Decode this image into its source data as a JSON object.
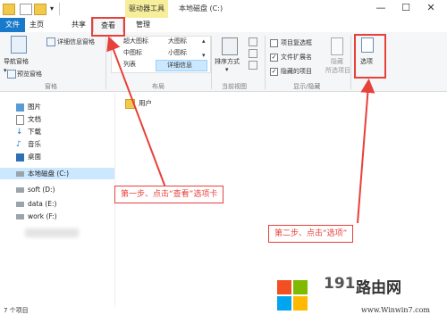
{
  "titlebar": {
    "context_tab": "驱动器工具",
    "title": "本地磁盘 (C:)",
    "minimize": "—",
    "maximize": "☐",
    "close": "✕"
  },
  "tabs": {
    "file": "文件",
    "home": "主页",
    "share": "共享",
    "view": "查看",
    "manage": "管理"
  },
  "ribbon": {
    "panes": {
      "nav_pane": "导航窗格",
      "preview_pane": "预览窗格",
      "details_pane": "详细信息窗格",
      "group": "窗格"
    },
    "layout": {
      "items": [
        "超大图标",
        "大图标",
        "中图标",
        "小图标",
        "列表",
        "详细信息"
      ],
      "group": "布局"
    },
    "current_view": {
      "sort": "排序方式",
      "group": "当前视图"
    },
    "show_hide": {
      "item_checkboxes": "项目复选框",
      "file_ext": "文件扩展名",
      "hidden_items": "隐藏的项目",
      "hide": "隐藏",
      "selected_items": "所选项目",
      "group": "显示/隐藏"
    },
    "options": {
      "label": "选项"
    }
  },
  "nav": {
    "items": [
      "图片",
      "文档",
      "下载",
      "音乐",
      "桌面",
      "本地磁盘 (C:)",
      "soft (D:)",
      "data (E:)",
      "work (F:)"
    ]
  },
  "content": {
    "folder": "用户"
  },
  "status": {
    "count": "7 个项目"
  },
  "annotations": {
    "step1": "第一步、点击“查看”选项卡",
    "step2": "第二步、点击“选项”"
  },
  "watermark": {
    "num": "191",
    "cn": "路由网",
    "url": "www.Winwin7.com"
  },
  "colors": {
    "accent": "#1979ca",
    "annotation": "#e8403a",
    "selection": "#cce8ff",
    "context_tab": "#f6ee9a"
  }
}
